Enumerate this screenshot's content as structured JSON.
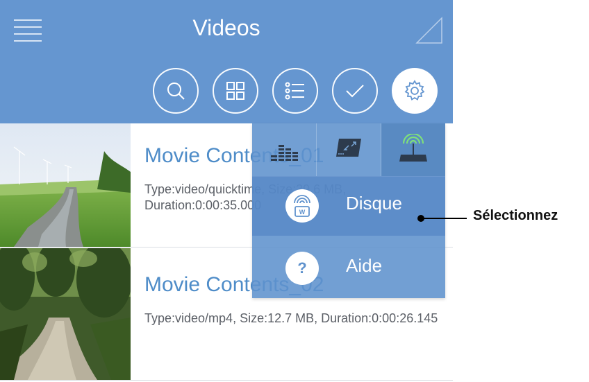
{
  "header": {
    "title": "Videos",
    "menu_icon": "hamburger-menu-icon",
    "corner_icon": "signal-triangle-icon"
  },
  "toolbar": {
    "buttons": [
      {
        "name": "search",
        "icon": "search-icon"
      },
      {
        "name": "grid-view",
        "icon": "grid-view-icon"
      },
      {
        "name": "list-view",
        "icon": "list-view-icon"
      },
      {
        "name": "select",
        "icon": "checkmark-icon"
      },
      {
        "name": "settings",
        "icon": "gear-icon",
        "active": true
      }
    ]
  },
  "videos": [
    {
      "title": "Movie Contents_01",
      "meta": "Type:video/quicktime, Size:39.6 MB, Duration:0:00:35.000"
    },
    {
      "title": "Movie Contents_02",
      "meta": "Type:video/mp4, Size:12.7 MB, Duration:0:00:26.145"
    }
  ],
  "dropdown": {
    "tabs": [
      {
        "icon": "equalizer-icon"
      },
      {
        "icon": "drive-transfer-icon"
      },
      {
        "icon": "wifi-drive-icon",
        "selected": true
      }
    ],
    "items": [
      {
        "label": "Disque",
        "icon": "wifi-disk-icon"
      },
      {
        "label": "Aide",
        "icon": "help-icon",
        "glyph": "?"
      }
    ]
  },
  "callout": {
    "text": "Sélectionnez"
  },
  "colors": {
    "header_bg": "#6596d0",
    "title_blue": "#4e8cc8",
    "wifi_green": "#7fe07a"
  }
}
